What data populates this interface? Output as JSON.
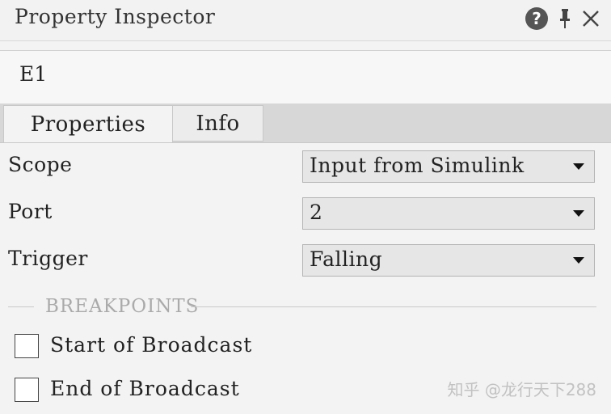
{
  "window": {
    "title": "Property Inspector",
    "icons": [
      "help-icon",
      "pin-icon",
      "close-icon"
    ],
    "help_glyph": "?"
  },
  "element_name": "E1",
  "tabs": [
    {
      "label": "Properties",
      "active": true
    },
    {
      "label": "Info",
      "active": false
    }
  ],
  "properties": {
    "scope": {
      "label": "Scope",
      "value": "Input from Simulink"
    },
    "port": {
      "label": "Port",
      "value": "2"
    },
    "trigger": {
      "label": "Trigger",
      "value": "Falling"
    }
  },
  "breakpoints": {
    "title": "BREAKPOINTS",
    "items": [
      {
        "label": "Start of Broadcast",
        "checked": false
      },
      {
        "label": "End of Broadcast",
        "checked": false
      }
    ]
  },
  "watermark": "知乎 @龙行天下288"
}
